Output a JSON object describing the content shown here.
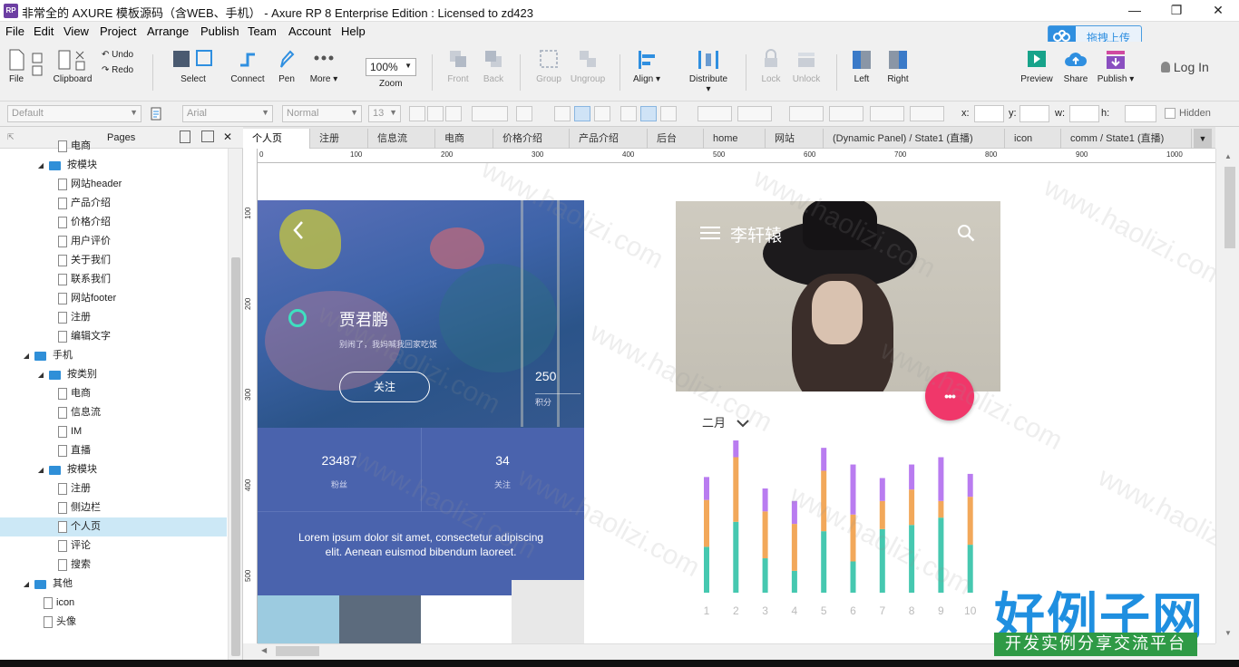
{
  "window": {
    "title": "非常全的 AXURE 模板源码（含WEB、手机） - Axure RP 8 Enterprise Edition : Licensed to zd423",
    "logo": "RP",
    "minimize": "—",
    "maximize": "❐",
    "close": "✕"
  },
  "menu": [
    "File",
    "Edit",
    "View",
    "Project",
    "Arrange",
    "Publish",
    "Team",
    "Account",
    "Help"
  ],
  "upload_button": "拖拽上传",
  "toolbar": {
    "file": "File",
    "clipboard": "Clipboard",
    "undo": "Undo",
    "redo": "Redo",
    "select": "Select",
    "connect": "Connect",
    "pen": "Pen",
    "more": "More ▾",
    "zoom_value": "100%",
    "zoom": "Zoom",
    "front": "Front",
    "back": "Back",
    "group": "Group",
    "ungroup": "Ungroup",
    "align": "Align ▾",
    "distribute": "Distribute ▾",
    "lock": "Lock",
    "unlock": "Unlock",
    "left": "Left",
    "right": "Right",
    "preview": "Preview",
    "share": "Share",
    "publish": "Publish ▾",
    "login": "Log In"
  },
  "stylebar": {
    "style": "Default",
    "font": "Arial",
    "weight": "Normal",
    "size": "13",
    "x_label": "x:",
    "y_label": "y:",
    "w_label": "w:",
    "h_label": "h:",
    "hidden": "Hidden"
  },
  "pages_panel": {
    "title": "Pages",
    "items": [
      {
        "label": "电商",
        "type": "page",
        "level": 3
      },
      {
        "label": "按模块",
        "type": "folder",
        "level": 2
      },
      {
        "label": "网站header",
        "type": "page",
        "level": 3
      },
      {
        "label": "产品介绍",
        "type": "page",
        "level": 3
      },
      {
        "label": "价格介绍",
        "type": "page",
        "level": 3
      },
      {
        "label": "用户评价",
        "type": "page",
        "level": 3
      },
      {
        "label": "关于我们",
        "type": "page",
        "level": 3
      },
      {
        "label": "联系我们",
        "type": "page",
        "level": 3
      },
      {
        "label": "网站footer",
        "type": "page",
        "level": 3
      },
      {
        "label": "注册",
        "type": "page",
        "level": 3
      },
      {
        "label": "编辑文字",
        "type": "page",
        "level": 3
      },
      {
        "label": "手机",
        "type": "folder",
        "level": 1
      },
      {
        "label": "按类别",
        "type": "folder",
        "level": 2
      },
      {
        "label": "电商",
        "type": "page",
        "level": 3
      },
      {
        "label": "信息流",
        "type": "page",
        "level": 3
      },
      {
        "label": "IM",
        "type": "page",
        "level": 3
      },
      {
        "label": "直播",
        "type": "page",
        "level": 3
      },
      {
        "label": "按模块",
        "type": "folder",
        "level": 2
      },
      {
        "label": "注册",
        "type": "page",
        "level": 3
      },
      {
        "label": "侧边栏",
        "type": "page",
        "level": 3
      },
      {
        "label": "个人页",
        "type": "page",
        "level": 3,
        "selected": true
      },
      {
        "label": "评论",
        "type": "page",
        "level": 3
      },
      {
        "label": "搜索",
        "type": "page",
        "level": 3
      },
      {
        "label": "其他",
        "type": "folder",
        "level": 1
      },
      {
        "label": "icon",
        "type": "page",
        "level": 2
      },
      {
        "label": "头像",
        "type": "page",
        "level": 2
      }
    ]
  },
  "tabs": [
    "个人页",
    "注册",
    "信息流",
    "电商",
    "价格介绍",
    "产品介绍",
    "后台",
    "home",
    "网站",
    "(Dynamic Panel) / State1 (直播)",
    "icon",
    "comm / State1 (直播)"
  ],
  "ruler": {
    "top": [
      "0",
      "100",
      "200",
      "300",
      "400",
      "500",
      "600",
      "700",
      "800",
      "900",
      "1000"
    ],
    "left": [
      "100",
      "200",
      "300",
      "400",
      "500"
    ]
  },
  "profile": {
    "name": "贾君鹏",
    "subtitle": "别闹了，我妈喊我回家吃饭",
    "follow": "关注",
    "score_value": "250",
    "score_label": "积分",
    "fans_value": "23487",
    "fans_label": "粉丝",
    "following_value": "34",
    "following_label": "关注",
    "lorem": "Lorem ipsum dolor sit amet, consectetur adipiscing elit. Aenean euismod bibendum laoreet."
  },
  "card": {
    "user": "李轩辕",
    "month": "二月",
    "fab": "•••"
  },
  "chart_data": {
    "type": "bar",
    "stacked": true,
    "categories": [
      "1",
      "2",
      "3",
      "4",
      "5",
      "6",
      "7",
      "8",
      "9",
      "10"
    ],
    "series": [
      {
        "values": [
          44,
          68,
          33,
          21,
          59,
          30,
          61,
          65,
          72,
          46
        ],
        "color": "#46c8b0"
      },
      {
        "values": [
          45,
          62,
          45,
          45,
          58,
          45,
          27,
          34,
          16,
          46
        ],
        "color": "#f2a85a"
      },
      {
        "values": [
          22,
          32,
          22,
          22,
          22,
          48,
          22,
          24,
          42,
          22
        ],
        "color": "#b97cf0"
      }
    ]
  },
  "watermark": "www.haolizi.com",
  "brand": {
    "name": "好例子网",
    "slogan": "开发实例分享交流平台"
  }
}
